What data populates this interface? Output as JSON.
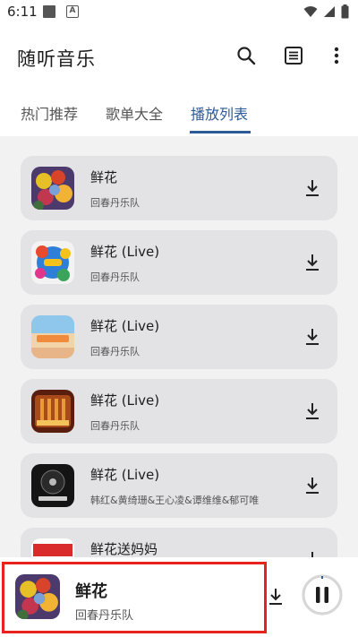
{
  "status_bar": {
    "time": "6:11",
    "badge_letter": "A"
  },
  "app_bar": {
    "title": "随听音乐"
  },
  "tabs": [
    {
      "label": "热门推荐",
      "active": false
    },
    {
      "label": "歌单大全",
      "active": false
    },
    {
      "label": "播放列表",
      "active": true
    }
  ],
  "songs": [
    {
      "title": "鲜花",
      "artist": "回春丹乐队",
      "cover_icon": "flower-bouquet-cover"
    },
    {
      "title": "鲜花 (Live)",
      "artist": "回春丹乐队",
      "cover_icon": "music-festival-cover"
    },
    {
      "title": "鲜花 (Live)",
      "artist": "回春丹乐队",
      "cover_icon": "stage-show-cover"
    },
    {
      "title": "鲜花 (Live)",
      "artist": "回春丹乐队",
      "cover_icon": "concert-hall-cover"
    },
    {
      "title": "鲜花 (Live)",
      "artist": "韩红&黄绮珊&王心凌&谭维维&郁可唯",
      "cover_icon": "vinyl-record-cover"
    },
    {
      "title": "鲜花送妈妈",
      "artist": "",
      "cover_icon": "singer-show-cover"
    }
  ],
  "player": {
    "title": "鲜花",
    "artist": "回春丹乐队"
  },
  "colors": {
    "accent": "#2e5a99",
    "card_bg": "#e3e3e6",
    "highlight": "#e8221c"
  }
}
